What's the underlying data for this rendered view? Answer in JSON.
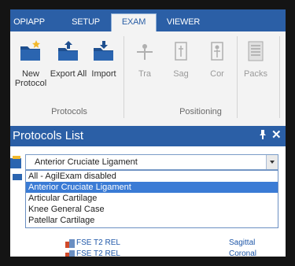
{
  "tabs": [
    {
      "label": "OPIAPP"
    },
    {
      "label": "SETUP"
    },
    {
      "label": "EXAM"
    },
    {
      "label": "VIEWER"
    }
  ],
  "ribbon": {
    "protocols_group": {
      "label": "Protocols",
      "buttons": [
        {
          "label": "New Protocol",
          "icon": "new-folder-icon"
        },
        {
          "label": "Export All",
          "icon": "export-folder-icon"
        },
        {
          "label": "Import",
          "icon": "import-folder-icon"
        }
      ]
    },
    "positioning_group": {
      "label": "Positioning",
      "buttons": [
        {
          "label": "Tra",
          "icon": "transverse-icon"
        },
        {
          "label": "Sag",
          "icon": "sagittal-icon"
        },
        {
          "label": "Cor",
          "icon": "coronal-icon"
        }
      ]
    },
    "packs_button": {
      "label": "Packs",
      "icon": "packs-icon"
    }
  },
  "panel": {
    "title": "Protocols List",
    "pin_glyph": "📌",
    "close_glyph": "✕"
  },
  "combo": {
    "value": "Anterior Cruciate Ligament",
    "options": [
      "All - AgilExam disabled",
      "Anterior Cruciate Ligament",
      "Articular Cartilage",
      "Knee General Case",
      "Patellar Cartilage"
    ],
    "selected_index": 1
  },
  "sequences": [
    {
      "name": "FSE T2 REL",
      "orientation": "Sagittal"
    },
    {
      "name": "FSE T2 REL",
      "orientation": "Coronal"
    }
  ],
  "colors": {
    "accent": "#2b5fa6",
    "selection": "#3a7bd5",
    "background": "#141414"
  }
}
